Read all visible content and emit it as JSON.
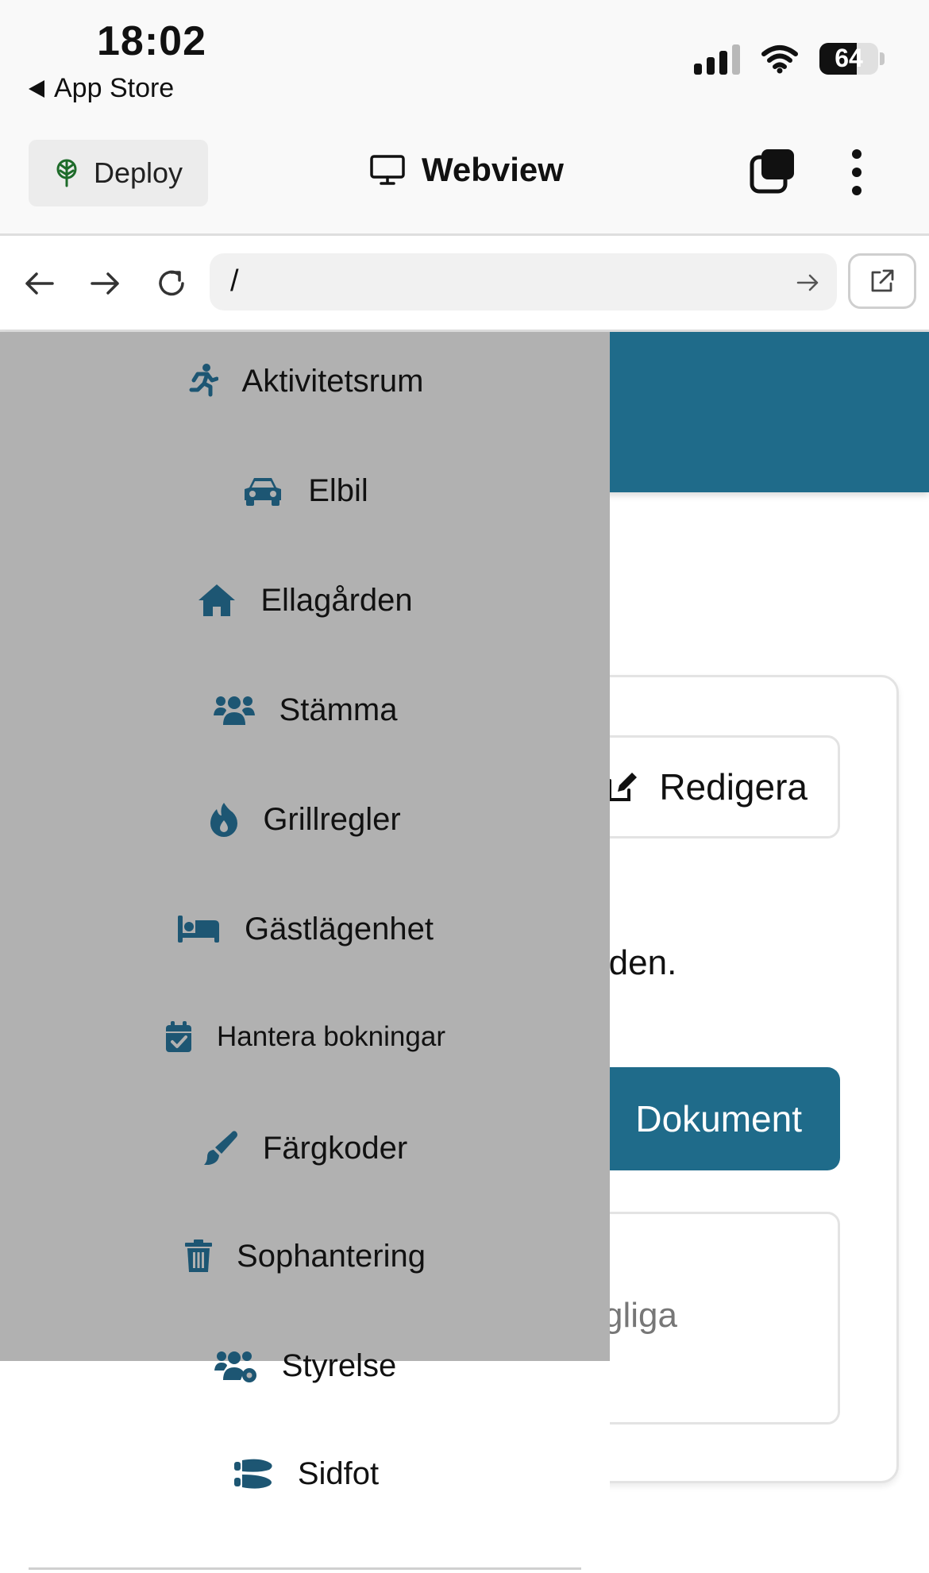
{
  "status_bar": {
    "time": "18:02",
    "back_label": "App Store",
    "battery": "64",
    "battery_level": 0.64
  },
  "toolbar": {
    "deploy_label": "Deploy",
    "title": "Webview"
  },
  "url_bar": {
    "url": "/"
  },
  "page": {
    "edit_label": "Redigera",
    "partial_text": "rden.",
    "document_label": "Dokument",
    "partial_card_text": "gliga"
  },
  "menu": {
    "items": [
      {
        "label": "Aktivitetsrum",
        "icon": "running-person-icon"
      },
      {
        "label": "Elbil",
        "icon": "car-icon"
      },
      {
        "label": "Ellagården",
        "icon": "home-icon"
      },
      {
        "label": "Stämma",
        "icon": "users-icon"
      },
      {
        "label": "Grillregler",
        "icon": "fire-icon"
      },
      {
        "label": "Gästlägenhet",
        "icon": "bed-icon"
      },
      {
        "label": "Hantera bokningar",
        "icon": "calendar-check-icon"
      },
      {
        "label": "Färgkoder",
        "icon": "paintbrush-icon"
      },
      {
        "label": "Sophantering",
        "icon": "trash-icon"
      },
      {
        "label": "Styrelse",
        "icon": "users-cog-icon"
      },
      {
        "label": "Sidfot",
        "icon": "shoe-prints-icon"
      }
    ]
  },
  "colors": {
    "accent": "#1f6b8a",
    "menu_overlay": "#b1b1b1",
    "icon": "#1d5673"
  }
}
